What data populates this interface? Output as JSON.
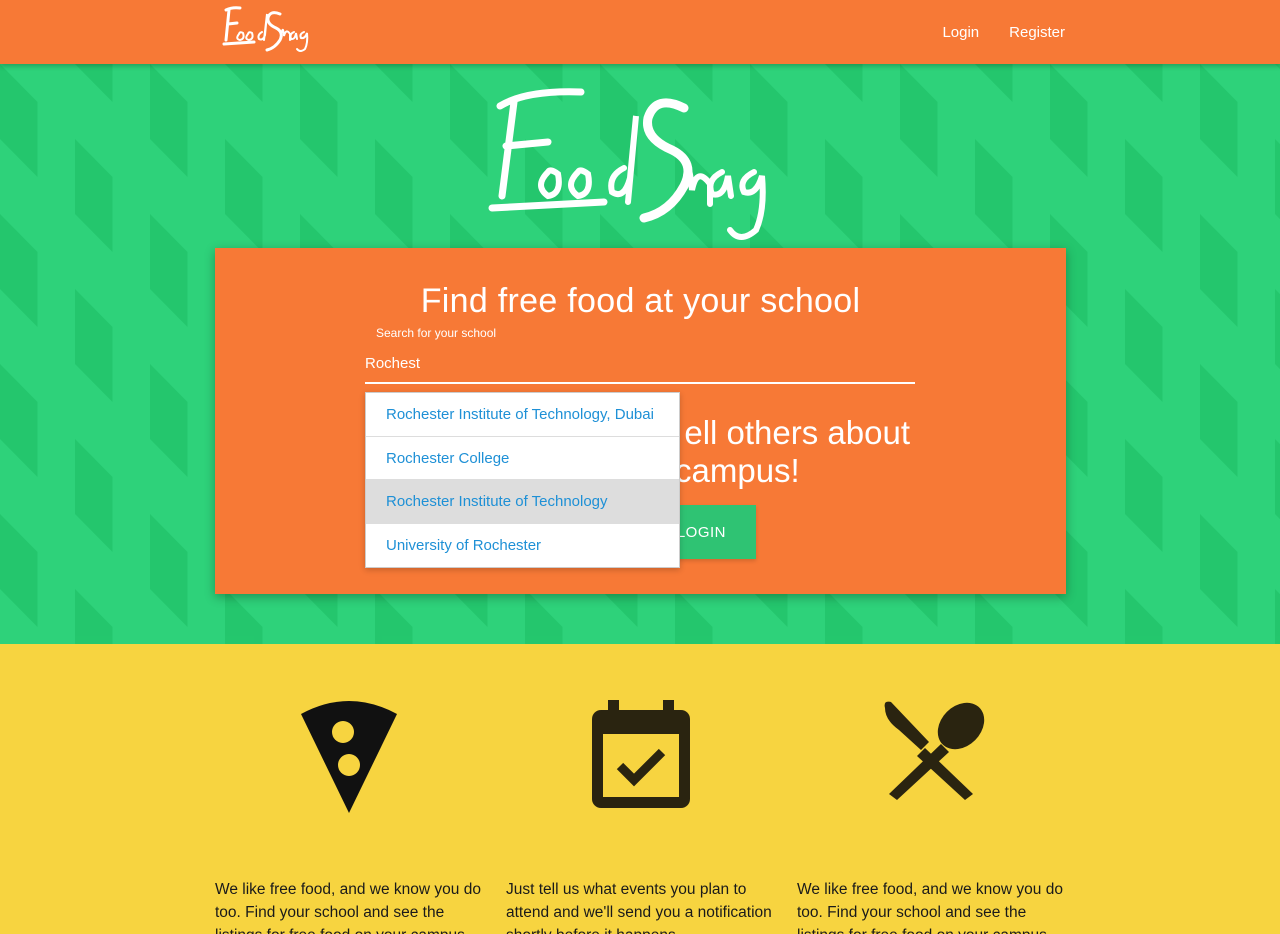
{
  "navbar": {
    "logo_text": "FoodSnag",
    "links": [
      "Login",
      "Register"
    ]
  },
  "hero": {
    "logo_text": "FoodSnag",
    "card": {
      "title": "Find free food at your school",
      "search_label": "Search for your school",
      "search_value": "Rochest",
      "subtitle_line1": "ell others about",
      "subtitle_line2": "campus!",
      "login_button": "LOGIN",
      "dropdown_items": [
        "Rochester Institute of Technology, Dubai",
        "Rochester College",
        "Rochester Institute of Technology",
        "University of Rochester"
      ],
      "dropdown_active_index": 2
    }
  },
  "features": [
    {
      "icon": "pizza-slice-icon",
      "text": "We like free food, and we know you do too. Find your school and see the listings for free food on your campus."
    },
    {
      "icon": "calendar-check-icon",
      "text": "Just tell us what events you plan to attend and we'll send you a notification shortly before it happens."
    },
    {
      "icon": "utensils-crossed-icon",
      "text": "We like free food, and we know you do too. Find your school and see the listings for free food on your campus."
    }
  ],
  "colors": {
    "navbar": "#f77936",
    "hero_green": "#2ed27a",
    "card_orange": "#f77936",
    "features_yellow": "#f7d440",
    "button_green": "#2fc373",
    "link_blue": "#1e90d6"
  }
}
